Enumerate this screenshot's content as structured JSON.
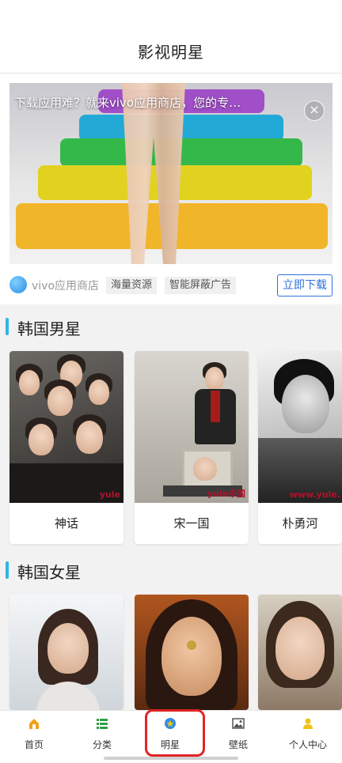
{
  "header": {
    "title": "影视明星"
  },
  "ad": {
    "caption": "下载应用难？就来vivo应用商店，您的专…",
    "close_glyph": "×",
    "store_name": "vivo应用商店",
    "tags": [
      "海量资源",
      "智能屏蔽广告"
    ],
    "download_label": "立即下载"
  },
  "sections": [
    {
      "title": "韩国男星",
      "cards": [
        {
          "name": "神话",
          "watermark": "yule"
        },
        {
          "name": "宋一国",
          "watermark": "yule中国"
        },
        {
          "name": "朴勇河",
          "watermark": "www.yule."
        }
      ]
    },
    {
      "title": "韩国女星",
      "cards": [
        {
          "name": ""
        },
        {
          "name": ""
        },
        {
          "name": ""
        }
      ]
    }
  ],
  "bottom_nav": [
    {
      "label": "首页",
      "icon": "home-icon",
      "color": "#f0a21a"
    },
    {
      "label": "分类",
      "icon": "list-icon",
      "color": "#2f9e47"
    },
    {
      "label": "明星",
      "icon": "star-face-icon",
      "color": "#2f8de4"
    },
    {
      "label": "壁纸",
      "icon": "image-icon",
      "color": "#555555"
    },
    {
      "label": "个人中心",
      "icon": "user-icon",
      "color": "#f0c21a"
    }
  ],
  "active_tab": "明星"
}
